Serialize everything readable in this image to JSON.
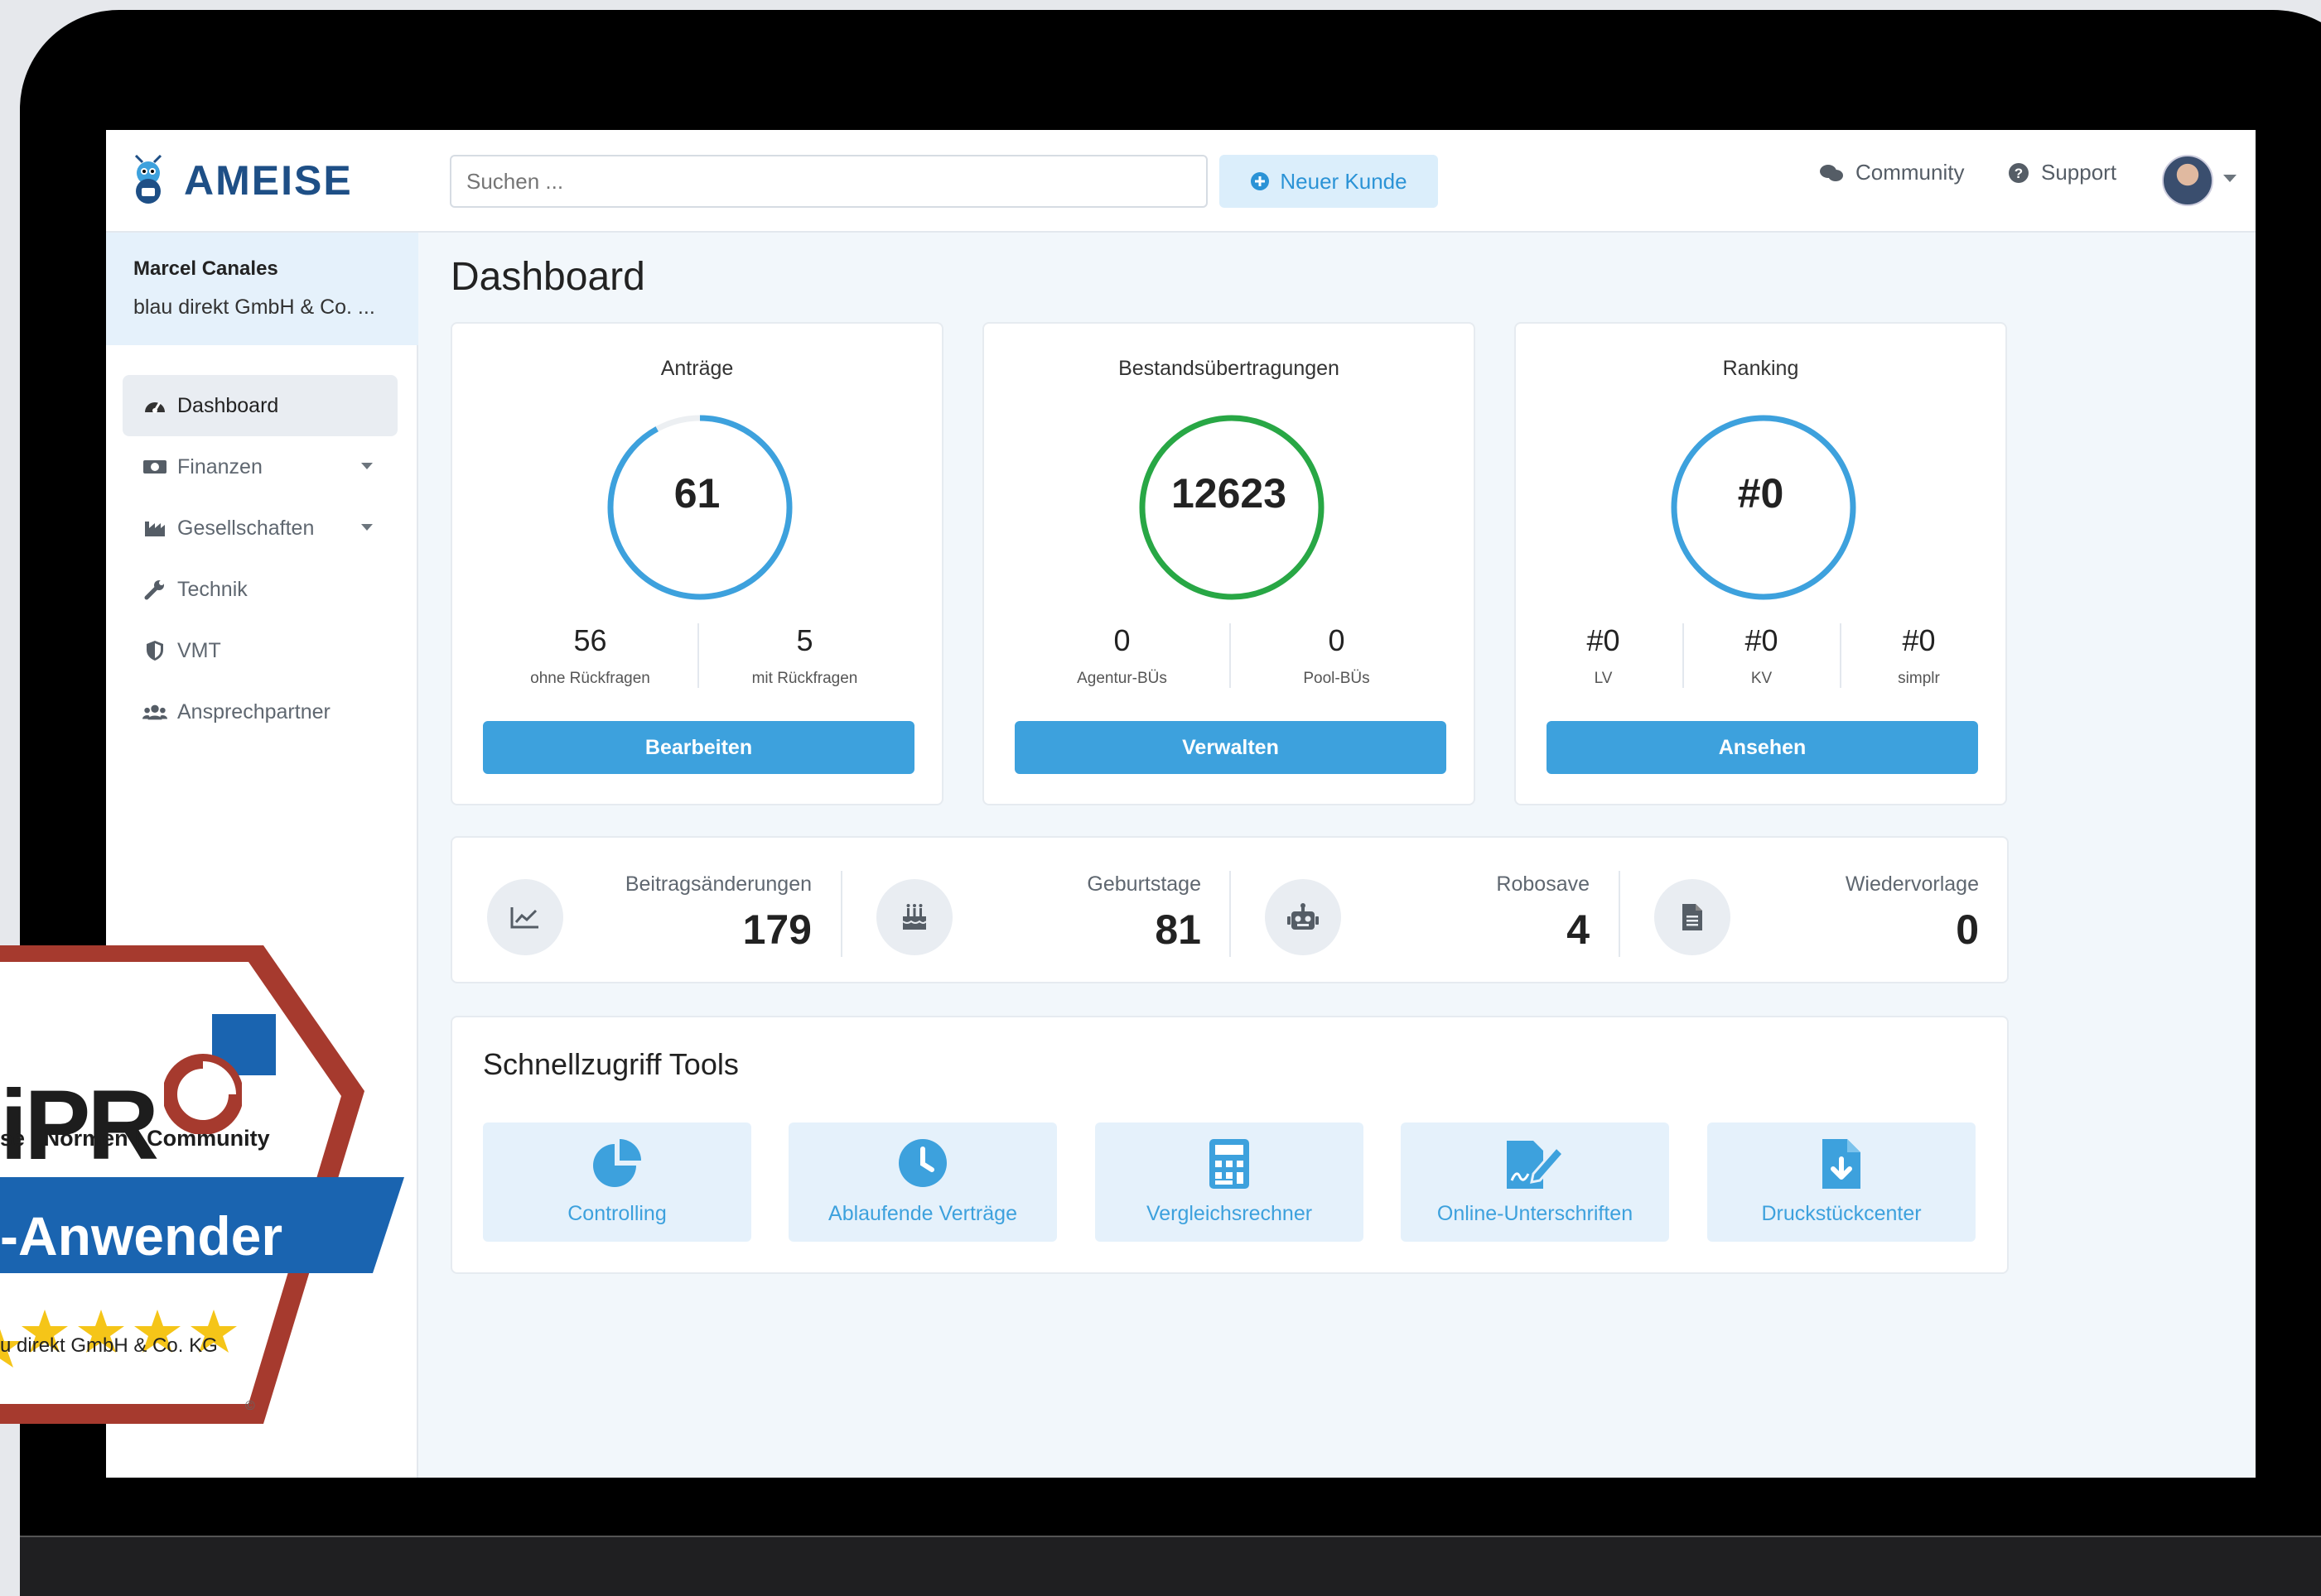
{
  "app": {
    "logo_text": "AMEISE",
    "page_title": "Dashboard"
  },
  "topbar": {
    "search_placeholder": "Suchen ...",
    "new_customer": "Neuer Kunde",
    "community": "Community",
    "support": "Support"
  },
  "user": {
    "name": "Marcel Canales",
    "company": "blau direkt GmbH & Co. ..."
  },
  "sidebar": {
    "items": [
      {
        "label": "Dashboard",
        "icon": "gauge-icon",
        "active": true
      },
      {
        "label": "Finanzen",
        "icon": "money-icon",
        "dropdown": true
      },
      {
        "label": "Gesellschaften",
        "icon": "industry-icon",
        "dropdown": true
      },
      {
        "label": "Technik",
        "icon": "wrench-icon"
      },
      {
        "label": "VMT",
        "icon": "shield-icon"
      },
      {
        "label": "Ansprechpartner",
        "icon": "users-icon"
      }
    ]
  },
  "cards": [
    {
      "title": "Anträge",
      "value": "61",
      "ring_color": "#3da1dd",
      "ring_progress": 0.92,
      "subs": [
        {
          "value": "56",
          "label": "ohne Rückfragen"
        },
        {
          "value": "5",
          "label": "mit Rückfragen"
        }
      ],
      "button": "Bearbeiten"
    },
    {
      "title": "Bestandsübertragungen",
      "value": "12623",
      "ring_color": "#28a745",
      "ring_progress": 1.0,
      "subs": [
        {
          "value": "0",
          "label": "Agentur-BÜs"
        },
        {
          "value": "0",
          "label": "Pool-BÜs"
        }
      ],
      "button": "Verwalten"
    },
    {
      "title": "Ranking",
      "value": "#0",
      "ring_color": "#3da1dd",
      "ring_progress": 1.0,
      "subs": [
        {
          "value": "#0",
          "label": "LV"
        },
        {
          "value": "#0",
          "label": "KV"
        },
        {
          "value": "#0",
          "label": "simplr"
        }
      ],
      "button": "Ansehen"
    }
  ],
  "counters": [
    {
      "label": "Beitragsänderungen",
      "value": "179",
      "icon": "chart-line-icon"
    },
    {
      "label": "Geburtstage",
      "value": "81",
      "icon": "birthday-cake-icon"
    },
    {
      "label": "Robosave",
      "value": "4",
      "icon": "robot-icon"
    },
    {
      "label": "Wiedervorlage",
      "value": "0",
      "icon": "file-icon"
    }
  ],
  "tools": {
    "title": "Schnellzugriff Tools",
    "items": [
      {
        "label": "Controlling",
        "icon": "pie-chart-icon"
      },
      {
        "label": "Ablaufende Verträge",
        "icon": "clock-icon"
      },
      {
        "label": "Vergleichsrechner",
        "icon": "calculator-icon"
      },
      {
        "label": "Online-Unterschriften",
        "icon": "signature-icon"
      },
      {
        "label": "Druckstückcenter",
        "icon": "file-download-icon"
      }
    ]
  },
  "badge": {
    "logo_text": "iPR",
    "tagline": "se | Normen | Community",
    "title": "-Anwender",
    "company": "u direkt GmbH & Co. KG",
    "copyright": "©",
    "stars": 5
  },
  "colors": {
    "accent": "#3da1dd",
    "brand": "#1e4f86",
    "success": "#28a745",
    "badge_red": "#a63a2e",
    "badge_blue": "#1a64b0",
    "star": "#f5c518"
  }
}
